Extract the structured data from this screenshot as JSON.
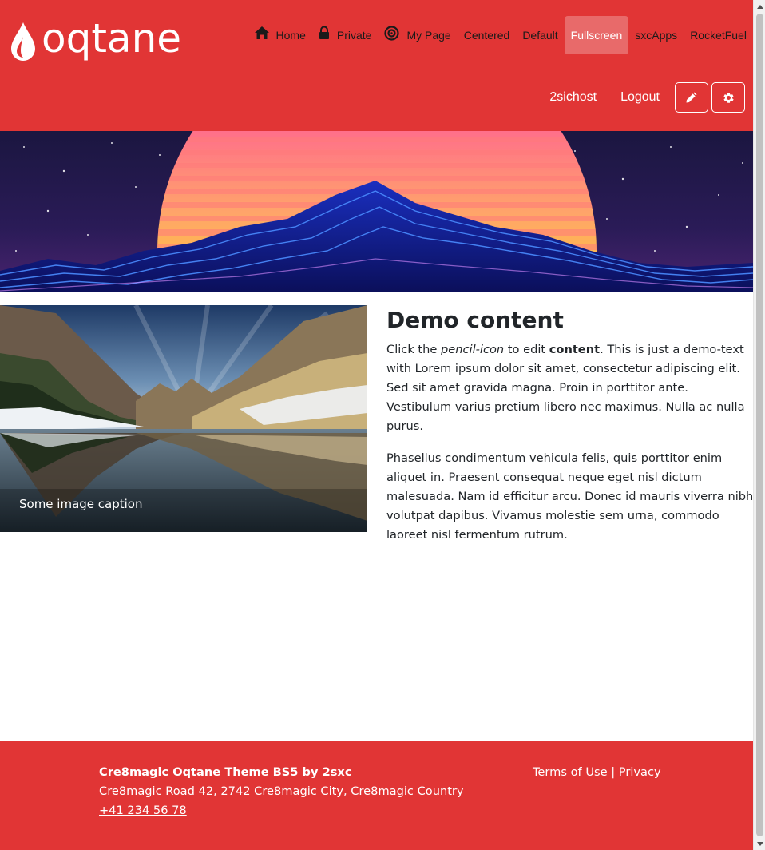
{
  "brand": {
    "logo_text": "oqtane"
  },
  "nav": {
    "items": [
      {
        "label": "Home",
        "icon": "home-icon"
      },
      {
        "label": "Private",
        "icon": "lock-icon"
      },
      {
        "label": "My Page",
        "icon": "target-icon"
      },
      {
        "label": "Centered"
      },
      {
        "label": "Default"
      },
      {
        "label": "Fullscreen",
        "active": true
      },
      {
        "label": "sxcApps"
      },
      {
        "label": "RocketFuel"
      }
    ]
  },
  "userbar": {
    "username": "2sichost",
    "logout": "Logout",
    "edit_icon": "pencil-icon",
    "settings_icon": "gear-icon"
  },
  "content": {
    "caption": "Some image caption",
    "heading": "Demo content",
    "p1_part1": "Click the ",
    "p1_em": "pencil-icon",
    "p1_part2": " to edit ",
    "p1_strong": "content",
    "p1_part3": ". This is just a demo-text with Lorem ipsum dolor sit amet, consectetur adipiscing elit. Sed sit amet gravida magna. Proin in porttitor ante. Vestibulum varius pretium libero nec maximus. Nulla ac nulla purus.",
    "p2": "Phasellus condimentum vehicula felis, quis porttitor enim aliquet in. Praesent consequat neque eget nisl dictum malesuada. Nam id efficitur arcu. Donec id mauris viverra nibh volutpat dapibus. Vivamus molestie sem urna, commodo laoreet nisl fermentum rutrum."
  },
  "footer": {
    "brand": "Cre8magic Oqtane Theme BS5 by 2sxc",
    "address": "Cre8magic Road 42, 2742 Cre8magic City, Cre8magic Country",
    "phone": "+41 234 56 78",
    "terms": "Terms of Use ",
    "separator": "|",
    "privacy": "Privacy"
  },
  "colors": {
    "brand_red": "#e13535",
    "active_nav": "#e86a6a"
  }
}
